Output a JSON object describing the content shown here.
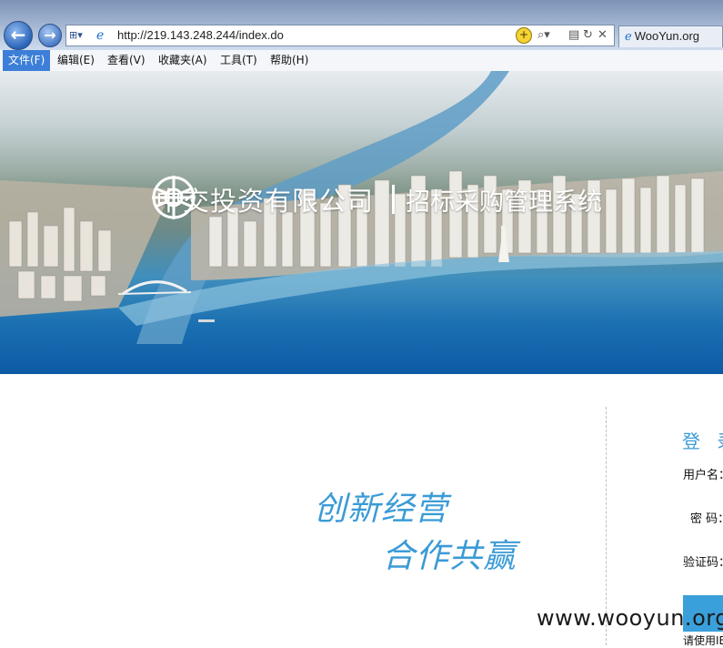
{
  "browser": {
    "url": "http://219.143.248.244/index.do",
    "tab_title": "WooYun.org",
    "back_glyph": "←",
    "forward_glyph": "→",
    "compat_glyph": "+",
    "search_glyph": "⚲",
    "refresh_glyph": "↻",
    "stop_glyph": "✕"
  },
  "menu": {
    "items": [
      {
        "label": "文件(F)"
      },
      {
        "label": "编辑(E)"
      },
      {
        "label": "查看(V)"
      },
      {
        "label": "收藏夹(A)"
      },
      {
        "label": "工具(T)"
      },
      {
        "label": "帮助(H)"
      }
    ],
    "active_index": 0
  },
  "banner": {
    "company": "中交投资有限公司",
    "system": "招标采购管理系统"
  },
  "main": {
    "slogan_line1": "创新经营",
    "slogan_line2": "合作共赢"
  },
  "login": {
    "title": "登 录",
    "username_label": "用户名：",
    "password_label": "密 码：",
    "captcha_label": "验证码：",
    "hint": "请使用IE"
  },
  "watermark": "www.wooyun.org",
  "colors": {
    "accent": "#3b9bd6",
    "button": "#3aa0db",
    "menu_active": "#3d7fd8"
  }
}
